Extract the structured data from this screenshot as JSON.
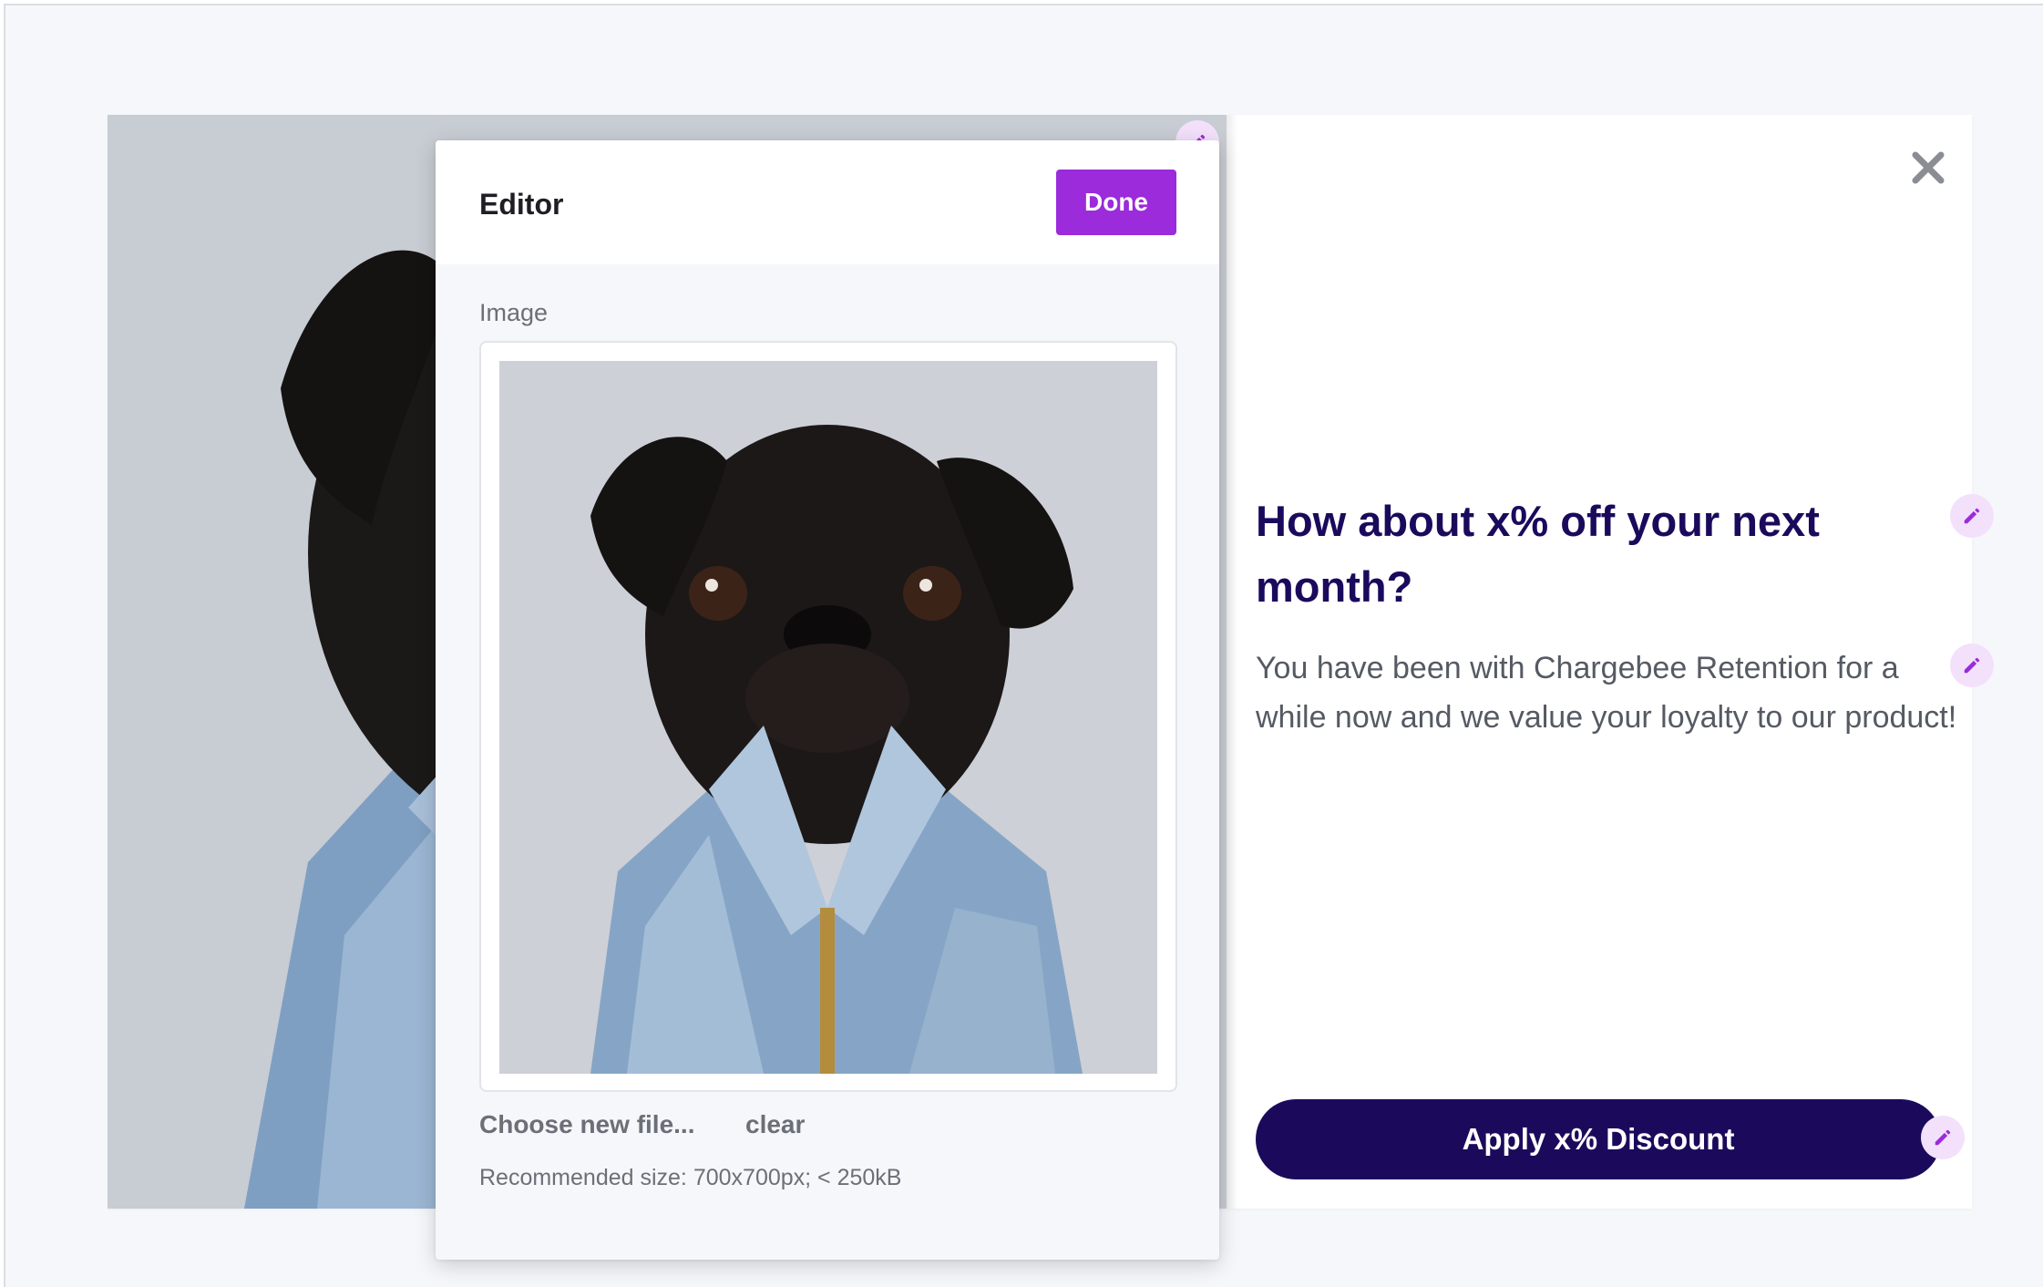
{
  "offer": {
    "title": "How about x% off your next month?",
    "description": "You have been with Chargebee Retention for a while now and we value your loyalty to our product!",
    "apply_label": "Apply x% Discount",
    "image_alt": "black pug wearing a denim jacket",
    "icons": {
      "close": "close-icon",
      "edit": "pencil-icon"
    }
  },
  "editor": {
    "title": "Editor",
    "done_label": "Done",
    "image_label": "Image",
    "choose_file_label": "Choose new file...",
    "clear_label": "clear",
    "hint": "Recommended size: 700x700px; < 250kB"
  },
  "colors": {
    "brand_navy": "#1b0a5c",
    "accent_purple": "#9b2bdb",
    "pencil_badge_bg": "#f3e1fb",
    "canvas_bg": "#f6f7fa"
  }
}
